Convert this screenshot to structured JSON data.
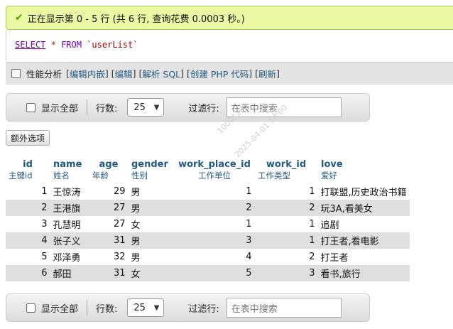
{
  "success_message": "正在显示第 0 - 5 行 (共 6 行, 查询花费 0.0003 秒。)",
  "sql": {
    "select": "SELECT",
    "star": "*",
    "from": "FROM",
    "table": "`userList`"
  },
  "query_tools": {
    "profiling": "性能分析",
    "links": [
      "编辑内嵌",
      "编辑",
      "解析 SQL",
      "创建 PHP 代码",
      "刷新"
    ]
  },
  "nav": {
    "show_all": "显示全部",
    "rows_label": "行数:",
    "rows_value": "25",
    "filter_label": "过滤行:",
    "filter_placeholder": "在表中搜索"
  },
  "extra_options": "额外选项",
  "columns": [
    {
      "name": "id",
      "comment": "主键id"
    },
    {
      "name": "name",
      "comment": "姓名"
    },
    {
      "name": "age",
      "comment": "年龄"
    },
    {
      "name": "gender",
      "comment": "性别"
    },
    {
      "name": "work_place_id",
      "comment": "工作单位"
    },
    {
      "name": "work_id",
      "comment": "工作类型"
    },
    {
      "name": "love",
      "comment": "爱好"
    }
  ],
  "rows": [
    [
      "1",
      "王惊涛",
      "29",
      "男",
      "1",
      "1",
      "打联盟,历史政治书籍"
    ],
    [
      "2",
      "王港旗",
      "27",
      "男",
      "2",
      "2",
      "玩3A,看美女"
    ],
    [
      "3",
      "孔慧明",
      "27",
      "女",
      "1",
      "1",
      "追剧"
    ],
    [
      "4",
      "张子义",
      "31",
      "男",
      "3",
      "1",
      "打王者,看电影"
    ],
    [
      "5",
      "邓泽勇",
      "32",
      "男",
      "4",
      "2",
      "打王者"
    ],
    [
      "6",
      "郝田",
      "31",
      "女",
      "5",
      "3",
      "看书,旅行"
    ]
  ],
  "watermark": [
    "10001205",
    "2025-04-01 14:00"
  ],
  "colors": {
    "success_bg": "#ebf8a4",
    "link": "#235a81",
    "row_alt": "#dfdfdf"
  }
}
